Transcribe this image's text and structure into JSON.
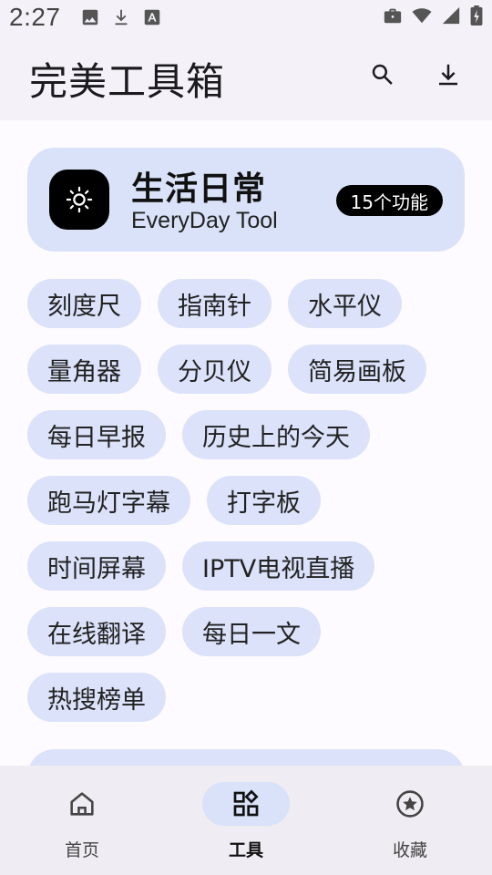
{
  "status_bar": {
    "time": "2:27",
    "icons": [
      "image-icon",
      "download-icon",
      "font-icon",
      "briefcase-icon",
      "wifi-icon",
      "signal-icon",
      "battery-icon"
    ]
  },
  "app_bar": {
    "title": "完美工具箱",
    "actions": [
      "search-icon",
      "download-icon"
    ]
  },
  "category": {
    "icon": "sun-icon",
    "title": "生活日常",
    "subtitle": "EveryDay Tool",
    "badge": "15个功能"
  },
  "chips": [
    [
      "刻度尺",
      "指南针",
      "水平仪"
    ],
    [
      "量角器",
      "分贝仪",
      "简易画板"
    ],
    [
      "每日早报",
      "历史上的今天"
    ],
    [
      "跑马灯字幕",
      "打字板"
    ],
    [
      "时间屏幕",
      "IPTV电视直播"
    ],
    [
      "在线翻译",
      "每日一文"
    ],
    [
      "热搜榜单"
    ]
  ],
  "bottom_nav": {
    "items": [
      {
        "label": "首页",
        "icon": "home-icon",
        "active": false
      },
      {
        "label": "工具",
        "icon": "apps-icon",
        "active": true
      },
      {
        "label": "收藏",
        "icon": "star-circle-icon",
        "active": false
      }
    ]
  },
  "colors": {
    "card_bg": "#d9e2f8",
    "chip_bg": "#dbe2f9",
    "badge_bg": "#000000",
    "nav_bg": "#efecf3"
  }
}
